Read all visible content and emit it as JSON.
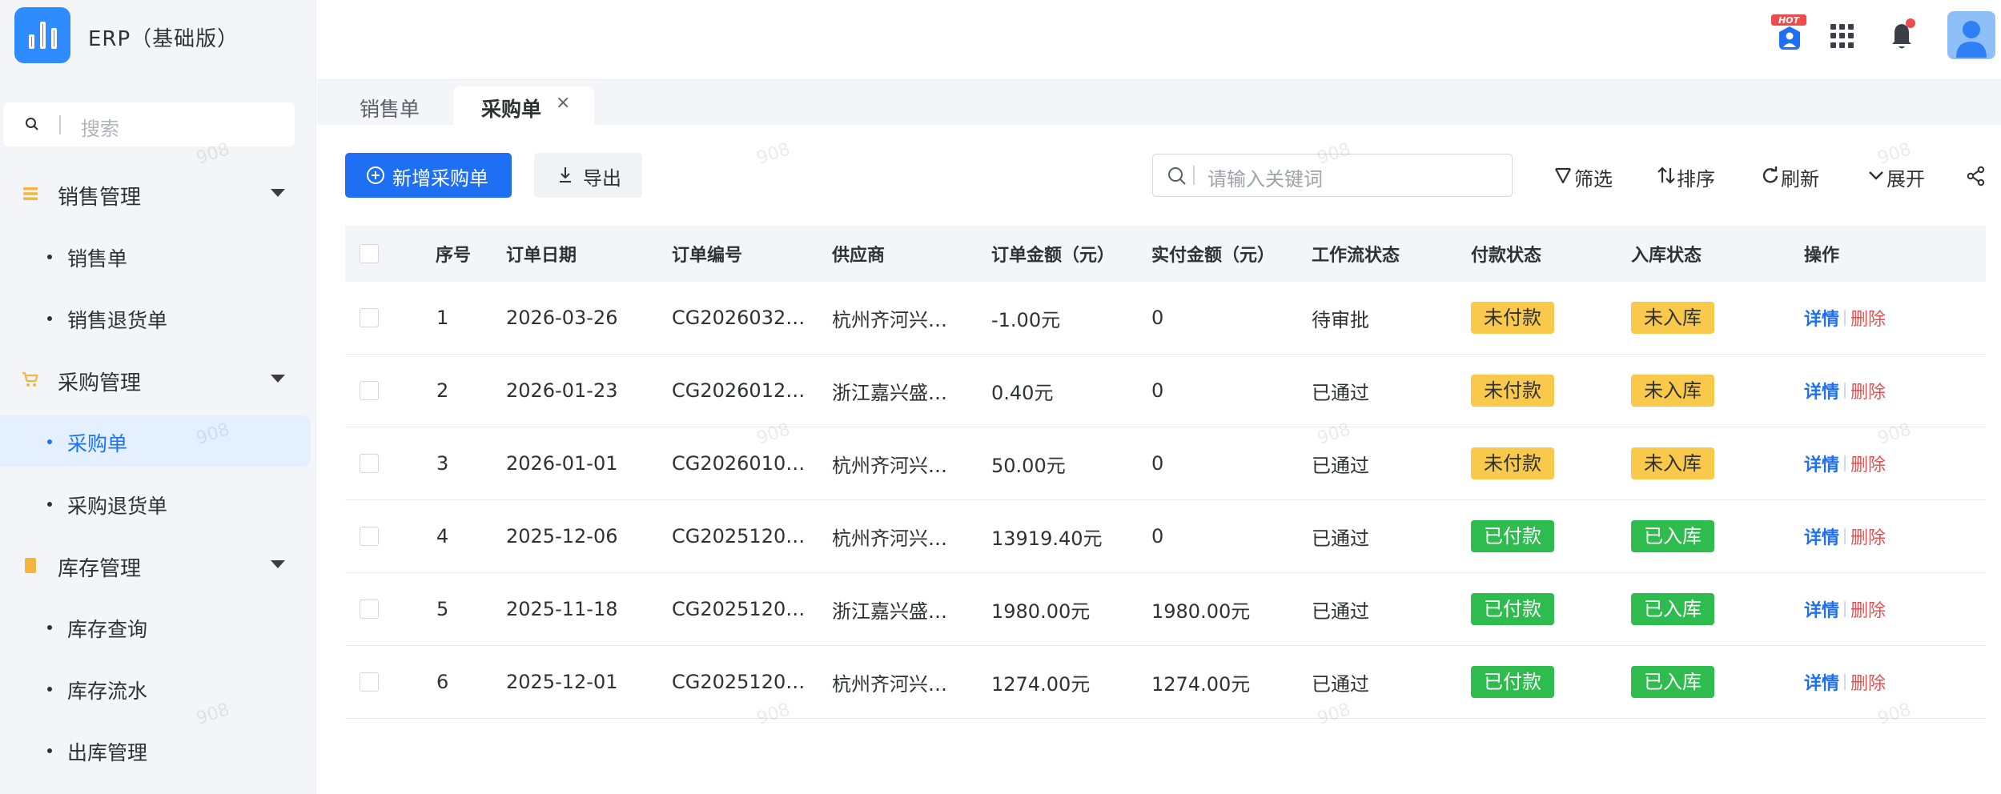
{
  "app": {
    "title": "ERP（基础版）"
  },
  "sidebar": {
    "search_placeholder": "搜索",
    "groups": [
      {
        "label": "销售管理",
        "items": [
          "销售单",
          "销售退货单"
        ]
      },
      {
        "label": "采购管理",
        "items": [
          "采购单",
          "采购退货单"
        ]
      },
      {
        "label": "库存管理",
        "items": [
          "库存查询",
          "库存流水",
          "出库管理"
        ]
      }
    ],
    "active_item": "采购单"
  },
  "header": {
    "hot_badge": "HOT"
  },
  "tabs": [
    {
      "label": "销售单",
      "active": false
    },
    {
      "label": "采购单",
      "active": true,
      "close": "×"
    }
  ],
  "toolbar": {
    "add_label": "新增采购单",
    "export_label": "导出",
    "search_placeholder": "请输入关键词",
    "filter_label": "筛选",
    "sort_label": "排序",
    "refresh_label": "刷新",
    "expand_label": "展开"
  },
  "table": {
    "columns": [
      "序号",
      "订单日期",
      "订单编号",
      "供应商",
      "订单金额（元）",
      "实付金额（元）",
      "工作流状态",
      "付款状态",
      "入库状态",
      "操作"
    ],
    "rows": [
      {
        "no": "1",
        "date": "2026-03-26",
        "code": "CG2026032…",
        "supplier": "杭州齐河兴…",
        "amount": "-1.00元",
        "paid": "0",
        "workflow": "待审批",
        "pay_status": "未付款",
        "stock_status": "未入库"
      },
      {
        "no": "2",
        "date": "2026-01-23",
        "code": "CG2026012…",
        "supplier": "浙江嘉兴盛…",
        "amount": "0.40元",
        "paid": "0",
        "workflow": "已通过",
        "pay_status": "未付款",
        "stock_status": "未入库"
      },
      {
        "no": "3",
        "date": "2026-01-01",
        "code": "CG2026010…",
        "supplier": "杭州齐河兴…",
        "amount": "50.00元",
        "paid": "0",
        "workflow": "已通过",
        "pay_status": "未付款",
        "stock_status": "未入库"
      },
      {
        "no": "4",
        "date": "2025-12-06",
        "code": "CG2025120…",
        "supplier": "杭州齐河兴…",
        "amount": "13919.40元",
        "paid": "0",
        "workflow": "已通过",
        "pay_status": "已付款",
        "stock_status": "已入库"
      },
      {
        "no": "5",
        "date": "2025-11-18",
        "code": "CG2025120…",
        "supplier": "浙江嘉兴盛…",
        "amount": "1980.00元",
        "paid": "1980.00元",
        "workflow": "已通过",
        "pay_status": "已付款",
        "stock_status": "已入库"
      },
      {
        "no": "6",
        "date": "2025-12-01",
        "code": "CG2025120…",
        "supplier": "杭州齐河兴…",
        "amount": "1274.00元",
        "paid": "1274.00元",
        "workflow": "已通过",
        "pay_status": "已付款",
        "stock_status": "已入库"
      }
    ],
    "actions": {
      "detail": "详情",
      "delete": "删除"
    }
  },
  "watermark": "908",
  "colors": {
    "primary": "#1f6ff5",
    "warn": "#f8c94a",
    "success": "#2ebc4f",
    "danger": "#f04b4b",
    "sidebar_bg": "#f3f5f8"
  },
  "icons": [
    "search-icon",
    "list-icon",
    "cart-icon",
    "box-icon",
    "chevron-down-icon",
    "hot-user-icon",
    "apps-grid-icon",
    "bell-icon",
    "user-avatar-icon",
    "plus-circle-icon",
    "download-icon",
    "filter-icon",
    "sort-icon",
    "refresh-icon",
    "share-icon",
    "close-icon"
  ]
}
